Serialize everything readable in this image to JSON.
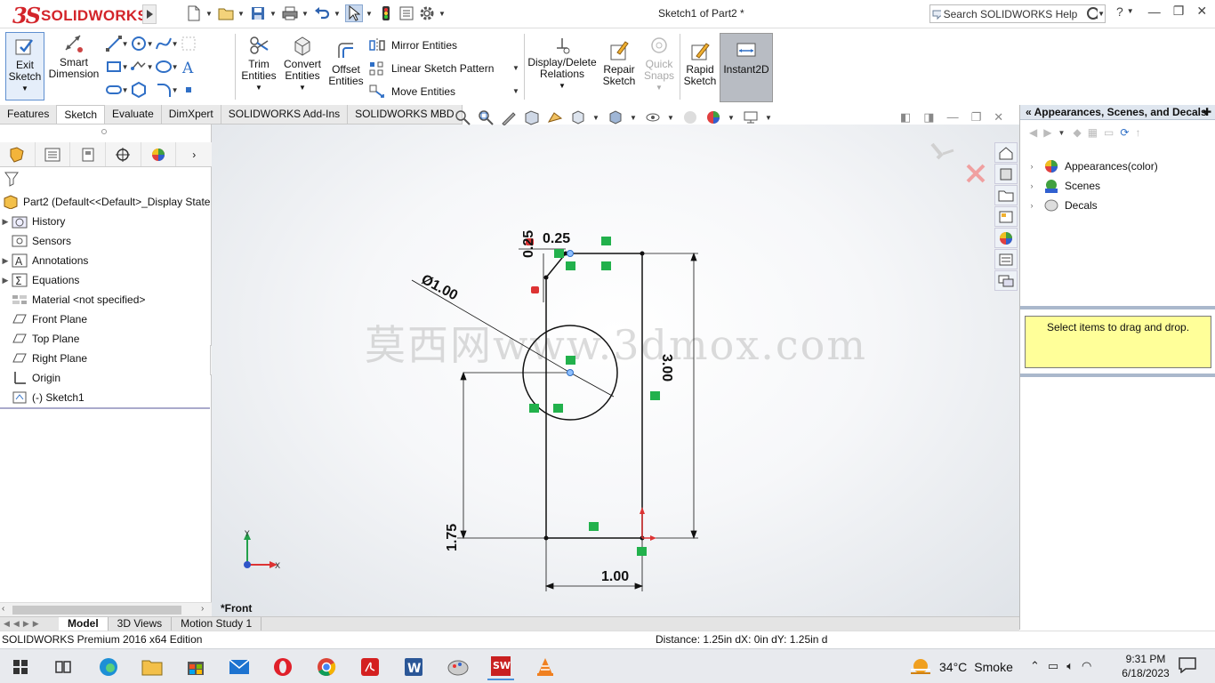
{
  "app": {
    "logo_mark": "3S",
    "logo_text": "SOLIDWORKS",
    "doc_title": "Sketch1 of Part2 *",
    "search_placeholder": "Search SOLIDWORKS Help",
    "help_label": "?"
  },
  "ribbon": {
    "exit_sketch": "Exit\nSketch",
    "exit_sketch_l1": "Exit",
    "exit_sketch_l2": "Sketch",
    "smart_dim_l1": "Smart",
    "smart_dim_l2": "Dimension",
    "trim_l1": "Trim",
    "trim_l2": "Entities",
    "convert_l1": "Convert",
    "convert_l2": "Entities",
    "offset_l1": "Offset",
    "offset_l2": "Entities",
    "mirror": "Mirror Entities",
    "linear_pattern": "Linear Sketch Pattern",
    "move": "Move Entities",
    "display_l1": "Display/Delete",
    "display_l2": "Relations",
    "repair_l1": "Repair",
    "repair_l2": "Sketch",
    "quick_l1": "Quick",
    "quick_l2": "Snaps",
    "rapid_l1": "Rapid",
    "rapid_l2": "Sketch",
    "instant2d": "Instant2D"
  },
  "command_tabs": [
    "Features",
    "Sketch",
    "Evaluate",
    "DimXpert",
    "SOLIDWORKS Add-Ins",
    "SOLIDWORKS MBD"
  ],
  "active_command_tab": "Sketch",
  "tree": {
    "root": "Part2  (Default<<Default>_Display State",
    "items": [
      "History",
      "Sensors",
      "Annotations",
      "Equations",
      "Material <not specified>",
      "Front Plane",
      "Top Plane",
      "Right Plane",
      "Origin",
      "(-) Sketch1"
    ]
  },
  "graphics": {
    "view_label": "*Front",
    "watermark": "莫西网www.3dmox.com",
    "dims": {
      "top_width": "0.25",
      "top_height": "0.25",
      "circle_dia": "Ø1.00",
      "total_height": "3.00",
      "center_height": "1.75",
      "bottom_width": "1.00"
    },
    "axis_x": "X",
    "axis_y": "Y"
  },
  "task_pane": {
    "title": "Appearances, Scenes, and Decals",
    "items": [
      "Appearances(color)",
      "Scenes",
      "Decals"
    ],
    "drop_hint": "Select items to drag and drop."
  },
  "bottom_tabs": [
    "Model",
    "3D Views",
    "Motion Study 1"
  ],
  "status": {
    "left": "SOLIDWORKS Premium 2016 x64 Edition",
    "right": "Distance: 1.25in   dX: 0in  dY: 1.25in  d"
  },
  "taskbar": {
    "weather_temp": "34°C",
    "weather_desc": "Smoke",
    "time": "9:31 PM",
    "date": "6/18/2023"
  },
  "colors": {
    "brand": "#d3242a",
    "sketch_line": "#111111",
    "relation_green": "#22b14c",
    "selection_blue": "#5f8fd0"
  }
}
